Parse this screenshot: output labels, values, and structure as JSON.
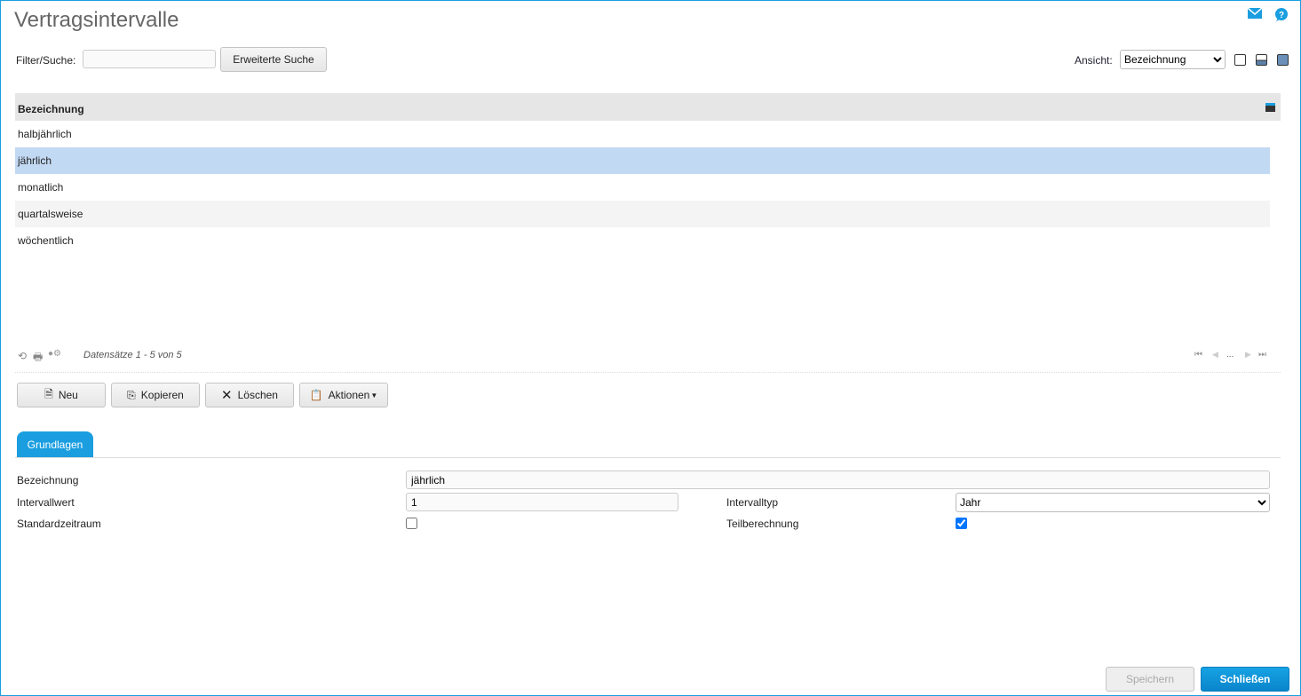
{
  "title": "Vertragsintervalle",
  "filter": {
    "label": "Filter/Suche:",
    "value": "",
    "adv_search": "Erweiterte Suche"
  },
  "view": {
    "label": "Ansicht:",
    "selected": "Bezeichnung"
  },
  "grid": {
    "header": "Bezeichnung",
    "rows": [
      "halbjährlich",
      "jährlich",
      "monatlich",
      "quartalsweise",
      "wöchentlich"
    ],
    "selected_index": 1,
    "records": "Datensätze 1 - 5 von 5",
    "pager_ellipsis": "..."
  },
  "toolbar": {
    "new": "Neu",
    "copy": "Kopieren",
    "delete": "Löschen",
    "actions": "Aktionen"
  },
  "tabs": {
    "basics": "Grundlagen"
  },
  "form": {
    "bez_label": "Bezeichnung",
    "bez_value": "jährlich",
    "iw_label": "Intervallwert",
    "iw_value": "1",
    "it_label": "Intervalltyp",
    "it_value": "Jahr",
    "std_label": "Standardzeitraum",
    "std_checked": false,
    "teil_label": "Teilberechnung",
    "teil_checked": true
  },
  "buttons": {
    "save": "Speichern",
    "close": "Schließen"
  },
  "colors": {
    "accent": "#1a9ee0",
    "selected_row": "#c2d9f3"
  }
}
